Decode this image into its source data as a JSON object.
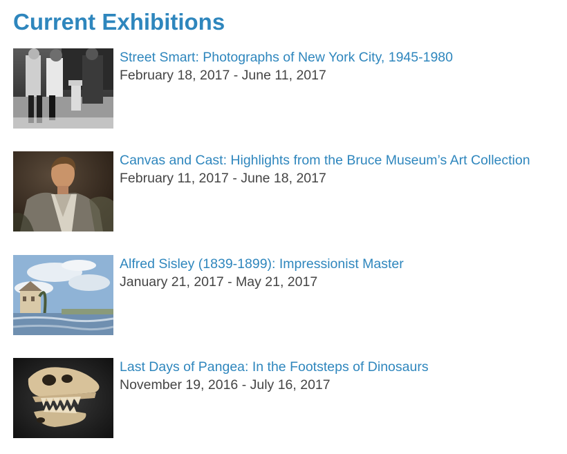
{
  "page": {
    "title": "Current Exhibitions",
    "accent_color": "#2e86bd",
    "text_color": "#444444"
  },
  "exhibitions": [
    {
      "title": "Street Smart: Photographs of New York City, 1945-1980",
      "dates": "February 18, 2017 - June 11, 2017",
      "thumbnail": "street-photo-thumbnail"
    },
    {
      "title": "Canvas and Cast: Highlights from the Bruce Museum’s Art Collection",
      "dates": "February 11, 2017 - June 18, 2017",
      "thumbnail": "portrait-painting-thumbnail"
    },
    {
      "title": "Alfred Sisley (1839-1899): Impressionist Master",
      "dates": "January 21, 2017 - May 21, 2017",
      "thumbnail": "impressionist-landscape-thumbnail"
    },
    {
      "title": "Last Days of Pangea: In the Footsteps of Dinosaurs",
      "dates": "November 19, 2016 - July 16, 2017",
      "thumbnail": "dinosaur-skull-thumbnail"
    }
  ]
}
